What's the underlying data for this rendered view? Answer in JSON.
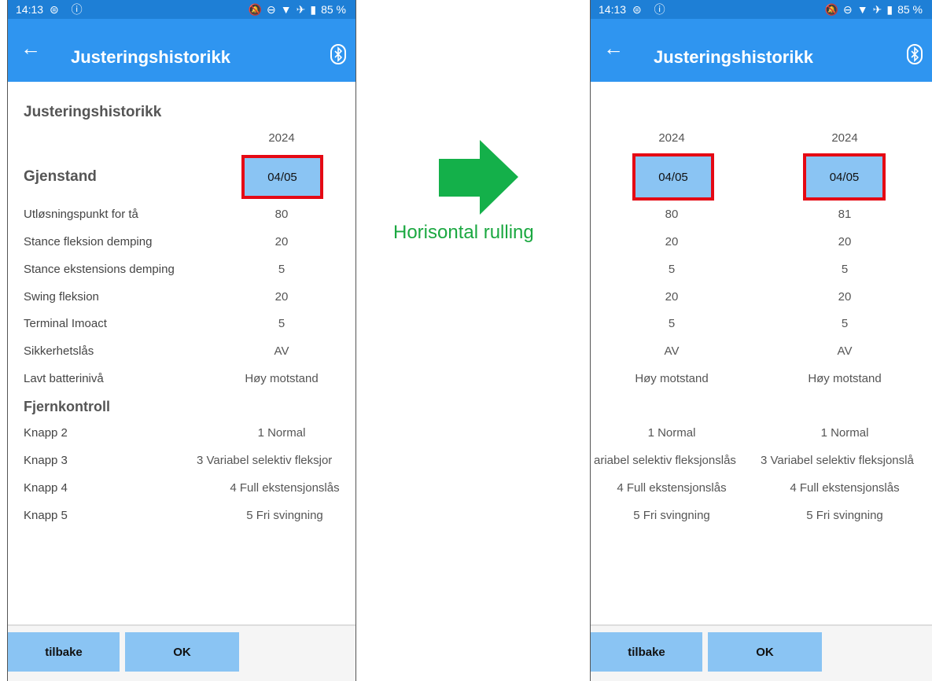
{
  "status": {
    "time": "14:13",
    "battery": "85 %"
  },
  "appbar": {
    "title": "Justeringshistorikk"
  },
  "left": {
    "section_title": "Justeringshistorikk",
    "year": "2024",
    "item_header": "Gjenstand",
    "date": "04/05",
    "rows": [
      {
        "label": "Utløsningspunkt for tå",
        "value": "80"
      },
      {
        "label": "Stance fleksion demping",
        "value": "20"
      },
      {
        "label": "Stance ekstensions demping",
        "value": "5"
      },
      {
        "label": "Swing fleksion",
        "value": "20"
      },
      {
        "label": "Terminal Imoact",
        "value": "5"
      },
      {
        "label": "Sikkerhetslås",
        "value": "AV"
      },
      {
        "label": "Lavt batterinivå",
        "value": "Høy motstand"
      }
    ],
    "remote_header": "Fjernkontroll",
    "remote_rows": [
      {
        "label": "Knapp 2",
        "value": "1 Normal"
      },
      {
        "label": "Knapp 3",
        "value": "3 Variabel selektiv fleksjor"
      },
      {
        "label": "Knapp 4",
        "value": "4 Full ekstensjonslås"
      },
      {
        "label": "Knapp 5",
        "value": "5 Fri svingning"
      }
    ]
  },
  "right": {
    "columns": [
      {
        "year": "2024",
        "date": "04/05",
        "values": [
          "80",
          "20",
          "5",
          "20",
          "5",
          "AV",
          "Høy motstand"
        ],
        "remote_values": [
          "1 Normal",
          "ariabel selektiv fleksjonslås",
          "4 Full ekstensjonslås",
          "5 Fri svingning"
        ]
      },
      {
        "year": "2024",
        "date": "04/05",
        "values": [
          "81",
          "20",
          "5",
          "20",
          "5",
          "AV",
          "Høy motstand"
        ],
        "remote_values": [
          "1 Normal",
          "3 Variabel selektiv fleksjonslå",
          "4 Full ekstensjonslås",
          "5 Fri svingning"
        ]
      }
    ]
  },
  "buttons": {
    "back": "tilbake",
    "ok": "OK"
  },
  "middle": {
    "caption": "Horisontal rulling"
  },
  "colors": {
    "appbar": "#2f95f0",
    "statusbar": "#1e7fd6",
    "date_fill": "#8ac4f3",
    "highlight": "#e50914",
    "arrow": "#14b04a"
  }
}
